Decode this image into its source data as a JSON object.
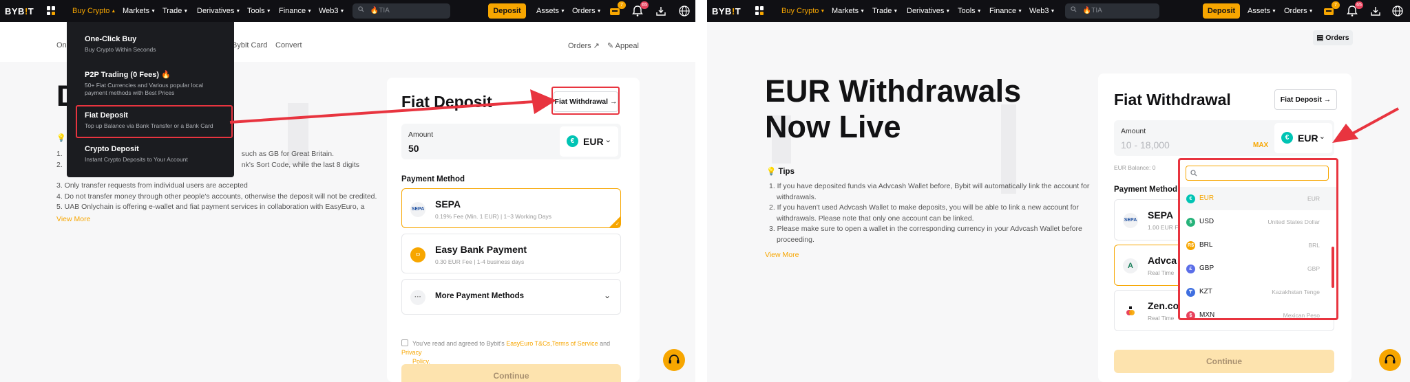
{
  "left": {
    "nav": {
      "logo_a": "BYB",
      "logo_b": "!",
      "logo_c": "T",
      "items": [
        "Buy Crypto",
        "Markets",
        "Trade",
        "Derivatives",
        "Tools",
        "Finance",
        "Web3"
      ],
      "search_placeholder": "TIA",
      "deposit_label": "Deposit",
      "assets_label": "Assets",
      "orders_label": "Orders",
      "badge_gift": "7",
      "badge_bell": "65"
    },
    "subnav": {
      "item_one": "One",
      "bybit_card": "Bybit Card",
      "convert": "Convert",
      "orders": "Orders ↗",
      "appeal": "Appeal"
    },
    "hero_letter": "D",
    "tips_lines": [
      "such as GB for Great Britain.",
      "nk's Sort Code, while the last 8 digits",
      "3. Only transfer requests from individual users are accepted",
      "4. Do not transfer money through other people's accounts, otherwise the deposit will not be credited.",
      "5. UAB Onlychain is offering e-wallet and fiat payment services in collaboration with EasyEuro, a"
    ],
    "tips_marker_one": "1.",
    "tips_marker_two": "2.",
    "view_more": "View More",
    "card": {
      "title": "Fiat Deposit",
      "switch_label": "Fiat Withdrawal →",
      "amount_label": "Amount",
      "amount_value": "50",
      "currency": "EUR",
      "currency_symbol": "€",
      "payment_method_label": "Payment Method",
      "methods": [
        {
          "name": "SEPA",
          "desc": "0.19% Fee (Min. 1 EUR)  |  1~3 Working Days",
          "icon": "SEPA"
        },
        {
          "name": "Easy Bank Payment",
          "desc": "0.30 EUR Fee  |  1-4 business days",
          "icon": ""
        }
      ],
      "more_methods": "More Payment Methods",
      "agree_prefix": "You've read and agreed to Bybit's ",
      "agree_link1": "EasyEuro T&Cs",
      "agree_sep": ",",
      "agree_link2": "Terms of Service",
      "agree_and": " and ",
      "agree_link3": "Privacy",
      "agree_link3b": "Policy",
      "agree_end": ".",
      "continue": "Continue"
    },
    "menu": {
      "items": [
        {
          "title": "One-Click Buy",
          "desc": "Buy Crypto Within Seconds"
        },
        {
          "title": "P2P Trading (0 Fees)",
          "desc1": "50+ Fiat Currencies and Various popular local",
          "desc2": "payment methods with Best Prices"
        },
        {
          "title": "Fiat Deposit",
          "desc": "Top up Balance via Bank Transfer or a Bank Card"
        },
        {
          "title": "Crypto Deposit",
          "desc": "Instant Crypto Deposits to Your Account"
        }
      ]
    }
  },
  "right": {
    "nav": {
      "logo_a": "BYB",
      "logo_b": "!",
      "logo_c": "T",
      "items": [
        "Buy Crypto",
        "Markets",
        "Trade",
        "Derivatives",
        "Tools",
        "Finance",
        "Web3"
      ],
      "search_placeholder": "TIA",
      "deposit_label": "Deposit",
      "assets_label": "Assets",
      "orders_label": "Orders",
      "badge_gift": "7",
      "badge_bell": "65"
    },
    "orders_button": "Orders",
    "hero_line1": "EUR Withdrawals",
    "hero_line2": "Now Live",
    "tips_title": "Tips",
    "tips_lines": [
      "1. If you have deposited funds via Advcash Wallet before, Bybit will automatically link the account for",
      "    withdrawals.",
      "2. If you haven't used Advcash Wallet to make deposits, you will be able to link a new account for",
      "    withdrawals. Please note that only one account can be linked.",
      "3. Please make sure to open a wallet in the corresponding currency in your Advcash Wallet before",
      "    proceeding."
    ],
    "view_more": "View More",
    "card": {
      "title": "Fiat Withdrawal",
      "switch_label": "Fiat Deposit →",
      "amount_label": "Amount",
      "amount_placeholder": "10 - 18,000",
      "max_label": "MAX",
      "currency": "EUR",
      "currency_symbol": "€",
      "balance": "EUR Balance: 0",
      "payment_method_label": "Payment Method",
      "methods": [
        {
          "name": "SEPA",
          "desc": "1.00 EUR F"
        },
        {
          "name": "Advca",
          "desc": "Real Time"
        },
        {
          "name": "Zen.co",
          "desc": "Real Time"
        }
      ],
      "continue": "Continue"
    },
    "currency_list": [
      {
        "code": "EUR",
        "name": "EUR",
        "symbol": "€",
        "color": "#00c4b4"
      },
      {
        "code": "USD",
        "name": "United States Dollar",
        "symbol": "$",
        "color": "#26b37a"
      },
      {
        "code": "BRL",
        "name": "BRL",
        "symbol": "R$",
        "color": "#f7a600"
      },
      {
        "code": "GBP",
        "name": "GBP",
        "symbol": "£",
        "color": "#5b6ee8"
      },
      {
        "code": "KZT",
        "name": "Kazakhstan Tenge",
        "symbol": "₸",
        "color": "#3f6fe0"
      },
      {
        "code": "MXN",
        "name": "Mexican Peso",
        "symbol": "$",
        "color": "#e8435e"
      }
    ]
  },
  "colors": {
    "accent": "#f7a600",
    "annotation_red": "#e8343f",
    "nav_bg": "#101014"
  }
}
